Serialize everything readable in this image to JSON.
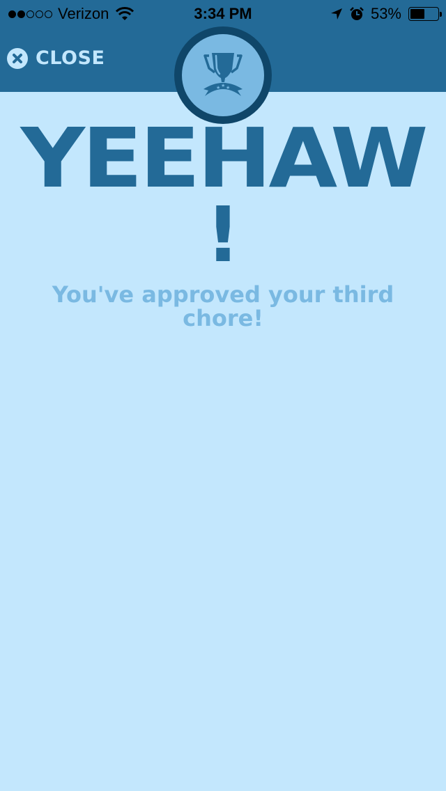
{
  "status_bar": {
    "signal_strength": 2,
    "signal_total": 5,
    "carrier": "Verizon",
    "time": "3:34 PM",
    "battery_percent_label": "53%",
    "battery_level": 0.53,
    "icons": [
      "wifi-icon",
      "location-arrow-icon",
      "alarm-icon",
      "battery-icon"
    ]
  },
  "header": {
    "close_label": "CLOSE",
    "close_icon": "close-circle-icon",
    "badge_icon": "trophy-ribbon-icon"
  },
  "content": {
    "headline": "YEEHAW",
    "exclamation": "!",
    "message": "You've approved your third chore!"
  },
  "colors": {
    "header_bg": "#236a97",
    "page_bg": "#c3e7fd",
    "badge_ring": "#0f4669",
    "badge_fill": "#7ab9e2",
    "headline": "#236a97",
    "message": "#7ab9e2"
  }
}
